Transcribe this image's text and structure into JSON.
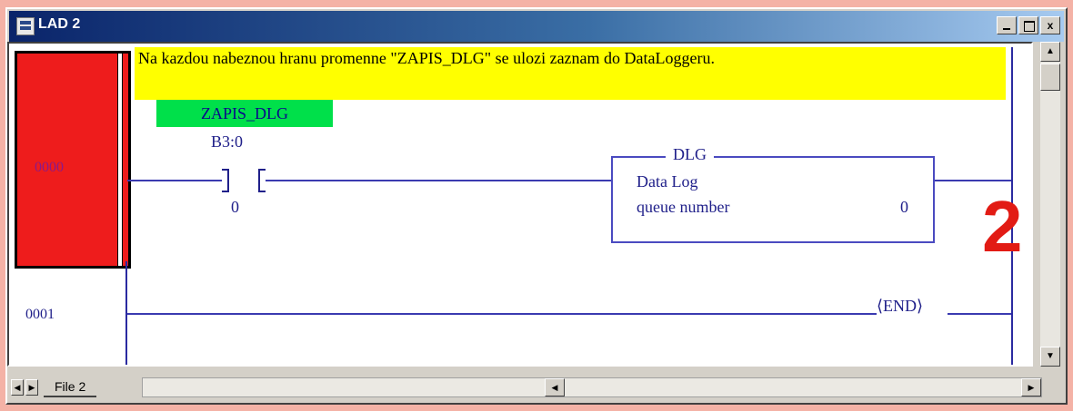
{
  "window": {
    "title": "LAD 2",
    "controls": {
      "close": "x"
    }
  },
  "rungs": [
    {
      "number": "0000",
      "comment": "Na kazdou nabeznou hranu promenne \"ZAPIS_DLG\" se ulozi zaznam do DataLoggeru.",
      "contact": {
        "symbol": "ZAPIS_DLG",
        "address": "B3:0",
        "bit": "0"
      },
      "instruction": {
        "mnemonic": "DLG",
        "name": "Data Log",
        "param_label": "queue number",
        "param_value": "0"
      }
    },
    {
      "number": "0001",
      "instruction": {
        "mnemonic": "END"
      }
    }
  ],
  "annotation": {
    "text": "2"
  },
  "tabs": {
    "active": "File 2"
  },
  "colors": {
    "selection": "#ee1c1c",
    "comment_bg": "#ffff00",
    "symbol_bg": "#00e04a",
    "wire": "#2a2aa0",
    "annotation": "#e21b14"
  },
  "icons": [
    "app-icon",
    "minimize-icon",
    "maximize-icon",
    "close-icon",
    "scroll-up-icon",
    "scroll-down-icon",
    "scroll-left-icon",
    "scroll-right-icon",
    "tab-first-icon",
    "tab-next-icon"
  ]
}
